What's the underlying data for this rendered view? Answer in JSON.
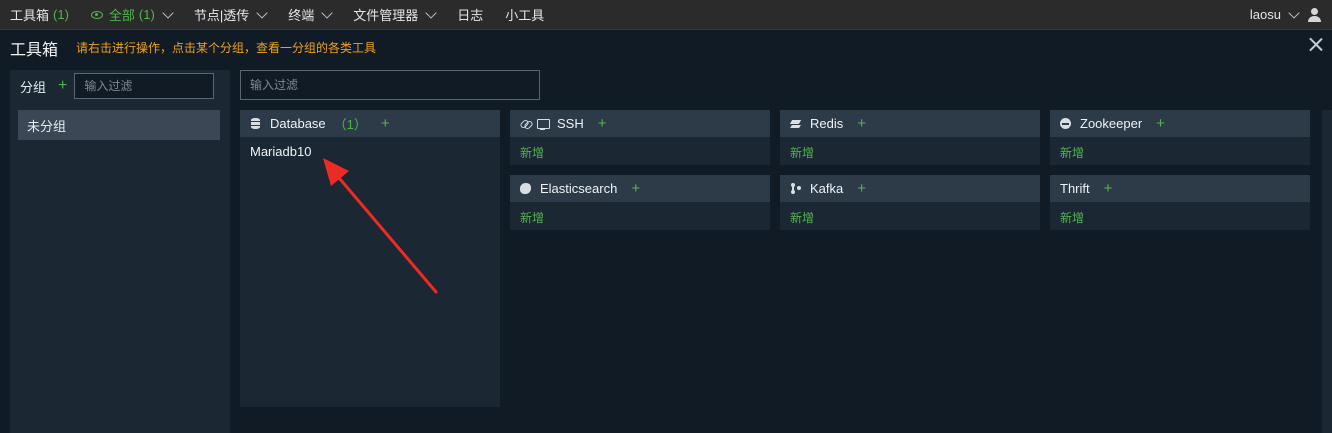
{
  "nav": {
    "toolbox": "工具箱",
    "toolbox_count": "(1)",
    "all": "全部",
    "all_count": "(1)",
    "items": [
      "节点|透传",
      "终端",
      "文件管理器",
      "日志",
      "小工具"
    ],
    "user": "laosu"
  },
  "header": {
    "title": "工具箱",
    "hint": "请右击进行操作，点击某个分组，查看一分组的各类工具"
  },
  "groups": {
    "label": "分组",
    "filter_placeholder": "输入过滤",
    "items": [
      "未分组"
    ]
  },
  "main": {
    "filter_placeholder": "输入过滤"
  },
  "cards": {
    "database": {
      "name": "Database",
      "count": "（1）",
      "items": [
        "Mariadb10"
      ]
    },
    "ssh": {
      "name": "SSH",
      "new": "新增"
    },
    "redis": {
      "name": "Redis",
      "new": "新增"
    },
    "zookeeper": {
      "name": "Zookeeper",
      "new": "新增"
    },
    "elasticsearch": {
      "name": "Elasticsearch",
      "new": "新增"
    },
    "kafka": {
      "name": "Kafka",
      "new": "新增"
    },
    "thrift": {
      "name": "Thrift",
      "new": "新增"
    }
  },
  "plus_symbol": "+",
  "colors": {
    "accent": "#51b54e",
    "hint": "#f0a020",
    "arrow": "#ee2a24"
  },
  "icons": {
    "database": "database-icon",
    "ssh": [
      "link-icon",
      "terminal-icon"
    ],
    "redis": "layers-icon",
    "zookeeper": "zookeeper-icon",
    "elasticsearch": "elasticsearch-icon",
    "kafka": "kafka-icon"
  }
}
